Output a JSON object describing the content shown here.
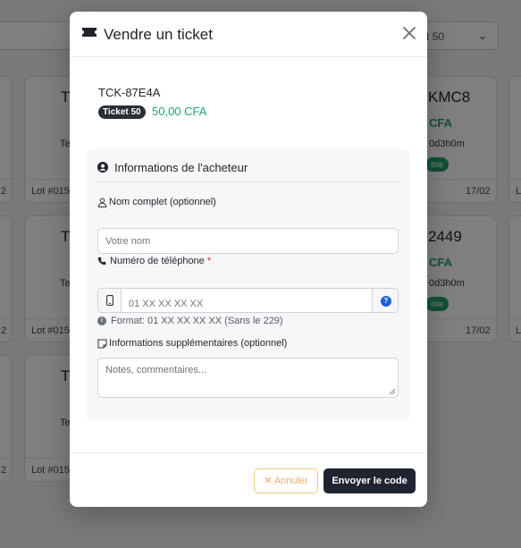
{
  "background": {
    "filter_select": "t 50",
    "cards": [
      {
        "code": "T",
        "dur": "Te",
        "lot": "Lot #015",
        "date": ""
      },
      {
        "code": "KMC8",
        "price": "CFA",
        "dur": "0d3h0m",
        "badge": "ible",
        "date": "17/02"
      },
      {
        "code": "T",
        "dur": "Te",
        "lot": "Lot #015",
        "date": ""
      },
      {
        "code": "2449",
        "price": "CFA",
        "dur": "0d3h0m",
        "badge": "ible",
        "date": "17/02"
      },
      {
        "code": "T",
        "dur": "Te",
        "lot": "Lot #015",
        "date": ""
      }
    ],
    "left_fragments": [
      "2",
      "2",
      "2"
    ],
    "right_fragments": [
      "L",
      "L"
    ]
  },
  "modal": {
    "title": "Vendre un ticket",
    "ticket": {
      "code": "TCK-87E4A",
      "badge": "Ticket 50",
      "price": "50,00 CFA"
    },
    "section_title": "Informations de l'acheteur",
    "name_field": {
      "label": "Nom complet (optionnel)",
      "placeholder": "Votre nom"
    },
    "phone_field": {
      "label": "Numéro de téléphone",
      "required_mark": "*",
      "placeholder": "01 XX XX XX XX",
      "hint": "Format: 01 XX XX XX XX (Sans le 229)"
    },
    "notes_field": {
      "label": "Informations supplémentaires (optionnel)",
      "placeholder": "Notes, commentaires..."
    },
    "buttons": {
      "cancel": "✕ Annuler",
      "submit": "Envoyer le code"
    }
  },
  "colors": {
    "accent_green": "#1fa36b",
    "primary_dark": "#1f2530",
    "cancel_orange": "#e8b064",
    "required_red": "#d4232f",
    "help_blue": "#1d5ed8"
  },
  "icons": [
    "ticket-icon",
    "close-icon",
    "user-circle-icon",
    "user-icon",
    "phone-icon",
    "mobile-icon",
    "question-icon",
    "info-icon",
    "note-icon",
    "chevron-down-icon"
  ]
}
